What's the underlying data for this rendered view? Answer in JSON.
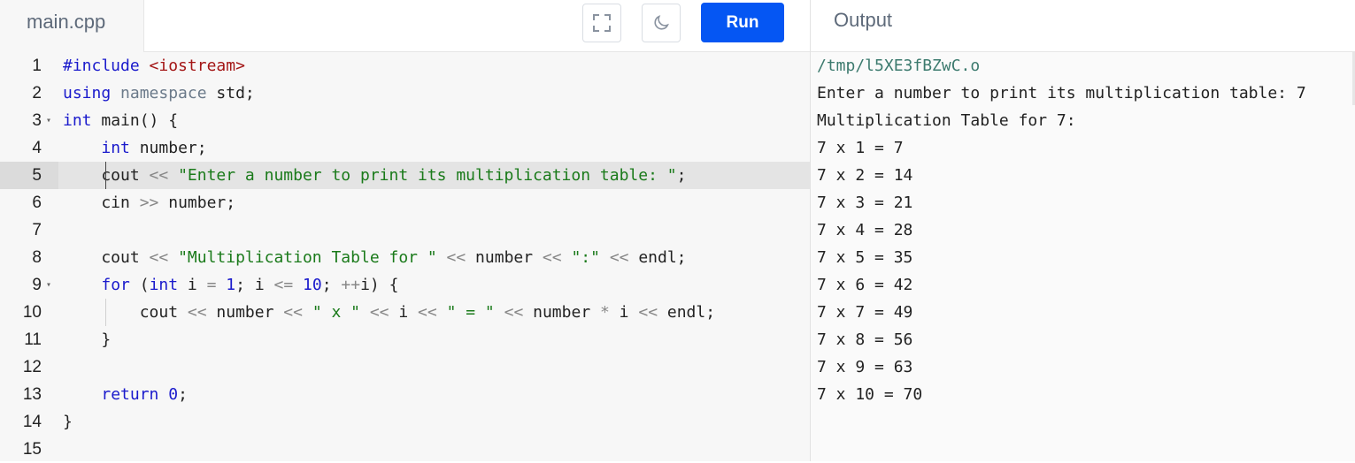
{
  "editor": {
    "file_tab": "main.cpp",
    "run_label": "Run",
    "fullscreen_icon": "fullscreen-icon",
    "theme_icon": "moon-icon",
    "active_line": 5
  },
  "output": {
    "title": "Output",
    "lines": [
      "/tmp/l5XE3fBZwC.o",
      "Enter a number to print its multiplication table: 7",
      "Multiplication Table for 7:",
      "7 x 1 = 7",
      "7 x 2 = 14",
      "7 x 3 = 21",
      "7 x 4 = 28",
      "7 x 5 = 35",
      "7 x 6 = 42",
      "7 x 7 = 49",
      "7 x 8 = 56",
      "7 x 9 = 63",
      "7 x 10 = 70"
    ]
  },
  "code": [
    {
      "n": "1",
      "tokens": [
        {
          "t": "#include ",
          "c": "kw"
        },
        {
          "t": "<iostream>",
          "c": "inc"
        }
      ]
    },
    {
      "n": "2",
      "tokens": [
        {
          "t": "using ",
          "c": "kw"
        },
        {
          "t": "namespace ",
          "c": "ns"
        },
        {
          "t": "std;",
          "c": ""
        }
      ]
    },
    {
      "n": "3",
      "fold": true,
      "tokens": [
        {
          "t": "int ",
          "c": "kw"
        },
        {
          "t": "main() {",
          "c": ""
        }
      ]
    },
    {
      "n": "4",
      "tokens": [
        {
          "t": "    ",
          "c": ""
        },
        {
          "t": "int ",
          "c": "kw"
        },
        {
          "t": "number;",
          "c": ""
        }
      ]
    },
    {
      "n": "5",
      "tokens": [
        {
          "t": "    cout ",
          "c": ""
        },
        {
          "t": "<<",
          "c": "op"
        },
        {
          "t": " ",
          "c": ""
        },
        {
          "t": "\"Enter a number to print its multiplication table: \"",
          "c": "str"
        },
        {
          "t": ";",
          "c": ""
        }
      ]
    },
    {
      "n": "6",
      "tokens": [
        {
          "t": "    cin ",
          "c": ""
        },
        {
          "t": ">>",
          "c": "op"
        },
        {
          "t": " number;",
          "c": ""
        }
      ]
    },
    {
      "n": "7",
      "tokens": []
    },
    {
      "n": "8",
      "tokens": [
        {
          "t": "    cout ",
          "c": ""
        },
        {
          "t": "<<",
          "c": "op"
        },
        {
          "t": " ",
          "c": ""
        },
        {
          "t": "\"Multiplication Table for \"",
          "c": "str"
        },
        {
          "t": " ",
          "c": ""
        },
        {
          "t": "<<",
          "c": "op"
        },
        {
          "t": " number ",
          "c": ""
        },
        {
          "t": "<<",
          "c": "op"
        },
        {
          "t": " ",
          "c": ""
        },
        {
          "t": "\":\"",
          "c": "str"
        },
        {
          "t": " ",
          "c": ""
        },
        {
          "t": "<<",
          "c": "op"
        },
        {
          "t": " endl;",
          "c": ""
        }
      ]
    },
    {
      "n": "9",
      "fold": true,
      "tokens": [
        {
          "t": "    ",
          "c": ""
        },
        {
          "t": "for ",
          "c": "kw"
        },
        {
          "t": "(",
          "c": ""
        },
        {
          "t": "int ",
          "c": "kw"
        },
        {
          "t": "i ",
          "c": ""
        },
        {
          "t": "=",
          "c": "op"
        },
        {
          "t": " ",
          "c": ""
        },
        {
          "t": "1",
          "c": "num"
        },
        {
          "t": "; i ",
          "c": ""
        },
        {
          "t": "<=",
          "c": "op"
        },
        {
          "t": " ",
          "c": ""
        },
        {
          "t": "10",
          "c": "num"
        },
        {
          "t": "; ",
          "c": ""
        },
        {
          "t": "++",
          "c": "op"
        },
        {
          "t": "i) {",
          "c": ""
        }
      ]
    },
    {
      "n": "10",
      "tokens": [
        {
          "t": "        cout ",
          "c": ""
        },
        {
          "t": "<<",
          "c": "op"
        },
        {
          "t": " number ",
          "c": ""
        },
        {
          "t": "<<",
          "c": "op"
        },
        {
          "t": " ",
          "c": ""
        },
        {
          "t": "\" x \"",
          "c": "str"
        },
        {
          "t": " ",
          "c": ""
        },
        {
          "t": "<<",
          "c": "op"
        },
        {
          "t": " i ",
          "c": ""
        },
        {
          "t": "<<",
          "c": "op"
        },
        {
          "t": " ",
          "c": ""
        },
        {
          "t": "\" = \"",
          "c": "str"
        },
        {
          "t": " ",
          "c": ""
        },
        {
          "t": "<<",
          "c": "op"
        },
        {
          "t": " number ",
          "c": ""
        },
        {
          "t": "*",
          "c": "op"
        },
        {
          "t": " i ",
          "c": ""
        },
        {
          "t": "<<",
          "c": "op"
        },
        {
          "t": " endl;",
          "c": ""
        }
      ]
    },
    {
      "n": "11",
      "tokens": [
        {
          "t": "    }",
          "c": ""
        }
      ]
    },
    {
      "n": "12",
      "tokens": []
    },
    {
      "n": "13",
      "tokens": [
        {
          "t": "    ",
          "c": ""
        },
        {
          "t": "return ",
          "c": "kw"
        },
        {
          "t": "0",
          "c": "num"
        },
        {
          "t": ";",
          "c": ""
        }
      ]
    },
    {
      "n": "14",
      "tokens": [
        {
          "t": "}",
          "c": ""
        }
      ]
    },
    {
      "n": "15",
      "tokens": []
    }
  ]
}
